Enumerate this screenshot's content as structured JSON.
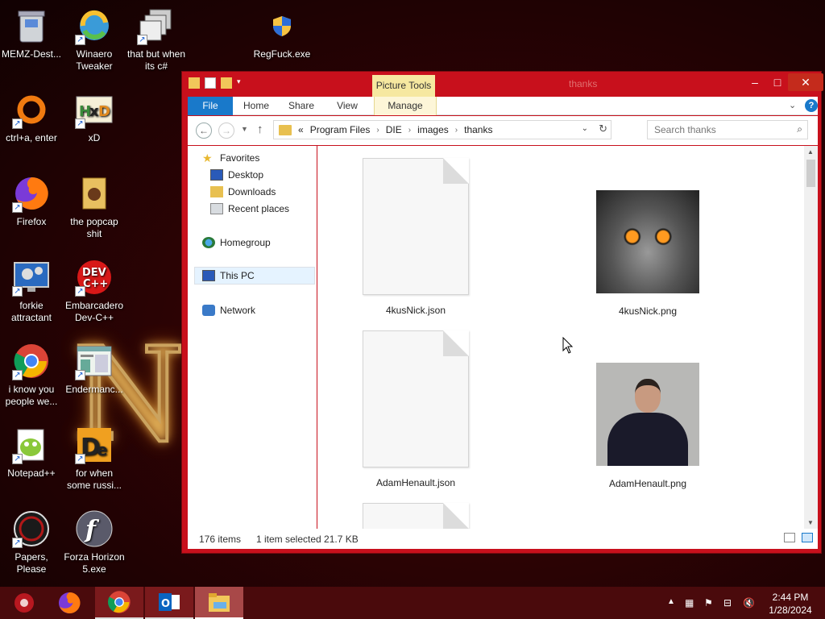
{
  "desktop": {
    "icons": [
      {
        "label": "MEMZ-Dest...",
        "icon": "recycle-bin-icon"
      },
      {
        "label": "Winaero Tweaker",
        "icon": "winaero-icon"
      },
      {
        "label": "that but when its c#",
        "icon": "stacked-windows-icon"
      },
      {
        "label": "RegFuck.exe",
        "icon": "shield-icon"
      },
      {
        "label": "ctrl+a, enter",
        "icon": "ring-icon"
      },
      {
        "label": "xD",
        "icon": "hxd-icon"
      },
      {
        "label": "Firefox",
        "icon": "firefox-icon"
      },
      {
        "label": "the popcap shit",
        "icon": "popcap-folder-icon"
      },
      {
        "label": "forkie attractant",
        "icon": "monitor-gear-icon"
      },
      {
        "label": "Embarcadero Dev-C++",
        "icon": "devcpp-icon"
      },
      {
        "label": "i know you people we...",
        "icon": "chrome-icon"
      },
      {
        "label": "Endermanc...",
        "icon": "webpage-icon"
      },
      {
        "label": "Notepad++",
        "icon": "notepadpp-icon"
      },
      {
        "label": "for when some russi...",
        "icon": "die-icon"
      },
      {
        "label": "Papers, Please",
        "icon": "papers-please-icon"
      },
      {
        "label": "Forza Horizon 5.exe",
        "icon": "flash-icon"
      }
    ]
  },
  "window": {
    "title": "thanks",
    "contextual_tab_group": "Picture Tools",
    "ribbon_tabs": [
      "File",
      "Home",
      "Share",
      "View",
      "Manage"
    ],
    "address": {
      "overflow": "«",
      "crumbs": [
        "Program Files",
        "DIE",
        "images",
        "thanks"
      ]
    },
    "search_placeholder": "Search thanks",
    "nav_pane": {
      "favorites": "Favorites",
      "desktop": "Desktop",
      "downloads": "Downloads",
      "recent_places": "Recent places",
      "homegroup": "Homegroup",
      "this_pc": "This PC",
      "network": "Network"
    },
    "files": [
      {
        "name": "4kusNick.json",
        "type": "document"
      },
      {
        "name": "4kusNick.png",
        "type": "owl-image"
      },
      {
        "name": "AdamHenault.json",
        "type": "document"
      },
      {
        "name": "AdamHenault.png",
        "type": "person-image"
      }
    ],
    "status": {
      "item_count": "176 items",
      "selection": "1 item selected  21.7 KB"
    }
  },
  "taskbar": {
    "clock_time": "2:44 PM",
    "clock_date": "1/28/2024"
  },
  "colors": {
    "window_frame": "#c8101c",
    "accent": "#1979ca",
    "taskbar": "#4a0a0c"
  }
}
